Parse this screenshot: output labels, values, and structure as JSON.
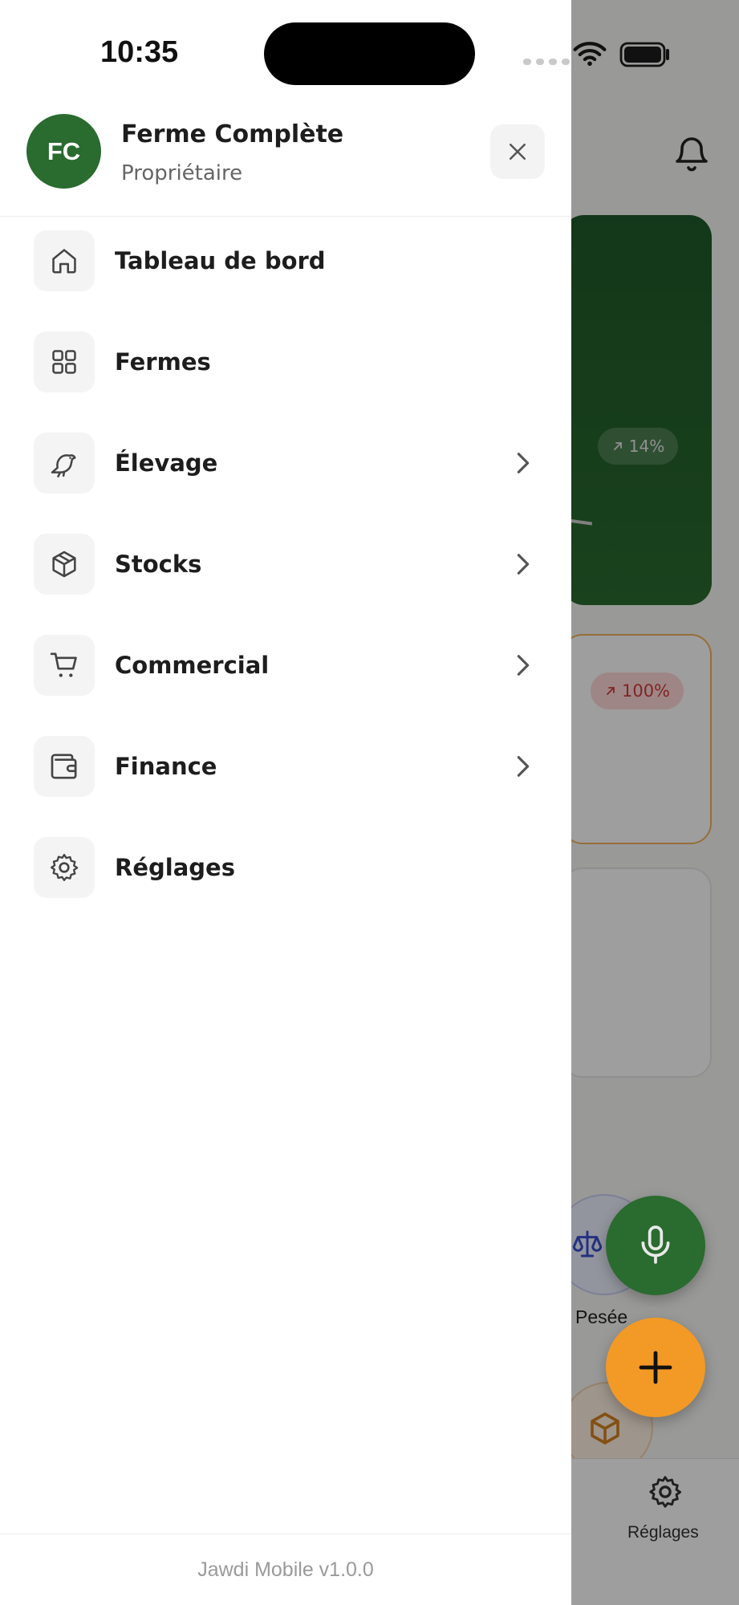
{
  "status_bar": {
    "time": "10:35"
  },
  "background": {
    "hero_trend": "14%",
    "alert_trend": "100%",
    "quick_action_label": "Pesée",
    "bottom_nav_label": "Réglages"
  },
  "drawer": {
    "avatar_initials": "FC",
    "farm_name": "Ferme Complète",
    "role": "Propriétaire",
    "menu": [
      {
        "label": "Tableau de bord",
        "icon": "home-icon",
        "has_submenu": false
      },
      {
        "label": "Fermes",
        "icon": "grid-icon",
        "has_submenu": false
      },
      {
        "label": "Élevage",
        "icon": "bird-icon",
        "has_submenu": true
      },
      {
        "label": "Stocks",
        "icon": "package-icon",
        "has_submenu": true
      },
      {
        "label": "Commercial",
        "icon": "cart-icon",
        "has_submenu": true
      },
      {
        "label": "Finance",
        "icon": "wallet-icon",
        "has_submenu": true
      },
      {
        "label": "Réglages",
        "icon": "settings-icon",
        "has_submenu": false
      }
    ],
    "version": "Jawdi Mobile v1.0.0"
  },
  "colors": {
    "brand_green": "#2a6b2f",
    "accent_orange": "#f29a25",
    "alert_red": "#d23b3b"
  }
}
